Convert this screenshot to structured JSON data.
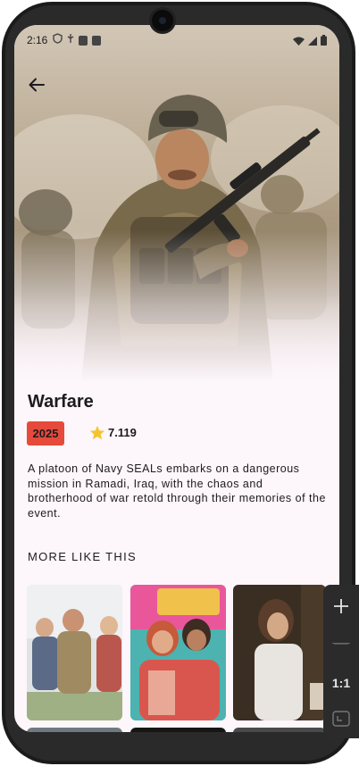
{
  "status_bar": {
    "time": "2:16"
  },
  "movie": {
    "title": "Warfare",
    "year": "2025",
    "rating": "7.119",
    "overview": "A platoon of Navy SEALs embarks on a dangerous mission in Ramadi, Iraq, with the chaos and brotherhood of war retold through their memories of the event."
  },
  "section": {
    "more_like_this": "MORE LIKE THIS"
  },
  "posters": [
    {
      "name": "poster-1"
    },
    {
      "name": "poster-2"
    },
    {
      "name": "poster-3"
    }
  ],
  "emulator_toolbar": {
    "zoom_label": "1:1"
  },
  "colors": {
    "accent_red": "#e64a3b",
    "star": "#f4c430",
    "background": "#fdf6fb"
  },
  "icons": [
    "arrow-back-icon",
    "star-icon",
    "plus-icon",
    "minus-icon",
    "fit-screen-icon"
  ]
}
